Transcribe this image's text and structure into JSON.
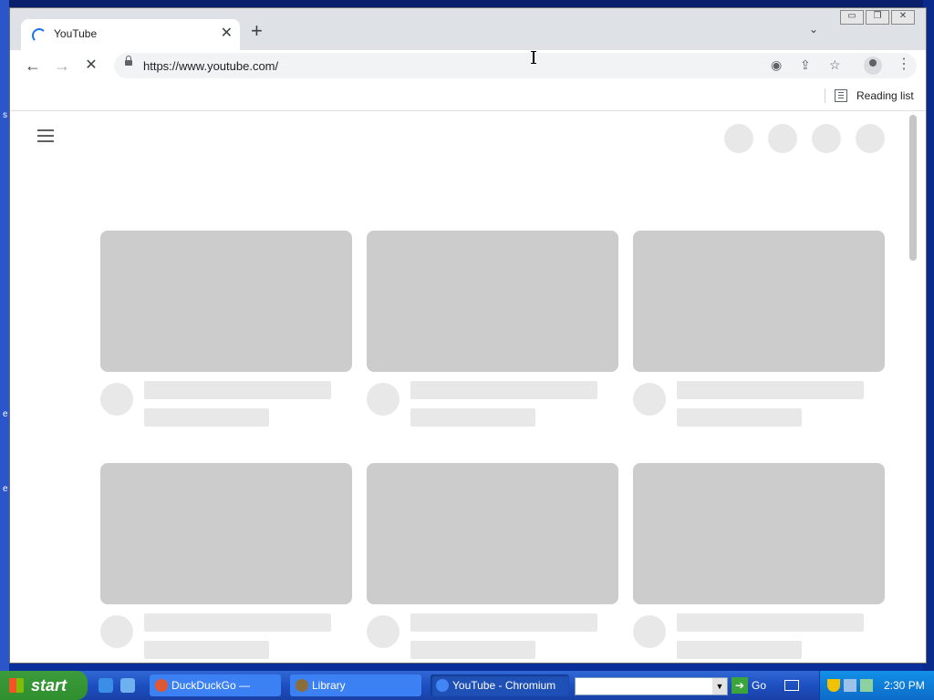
{
  "desktop": {
    "edge_letters": [
      "s",
      "e",
      "e"
    ]
  },
  "browser": {
    "tab_title": "YouTube",
    "tab_close_glyph": "✕",
    "new_tab_glyph": "+",
    "tab_search_glyph": "⌄",
    "url": "https://www.youtube.com/",
    "reading_list_label": "Reading list",
    "window_controls": [
      "▭",
      "❐",
      "✕"
    ],
    "back_glyph": "←",
    "forward_glyph": "→",
    "stop_glyph": "✕",
    "menu_glyph": "⋮"
  },
  "page": {
    "loading": true,
    "skeleton_cards": 6
  },
  "taskbar": {
    "start_label": "start",
    "tasks": [
      {
        "label": "DuckDuckGo — Priva…",
        "icon": "duckduckgo-icon"
      },
      {
        "label": "Library",
        "icon": "library-icon"
      },
      {
        "label": "YouTube - Chromium",
        "icon": "chromium-icon",
        "active": true
      }
    ],
    "go_label": "Go",
    "clock": "2:30 PM"
  }
}
